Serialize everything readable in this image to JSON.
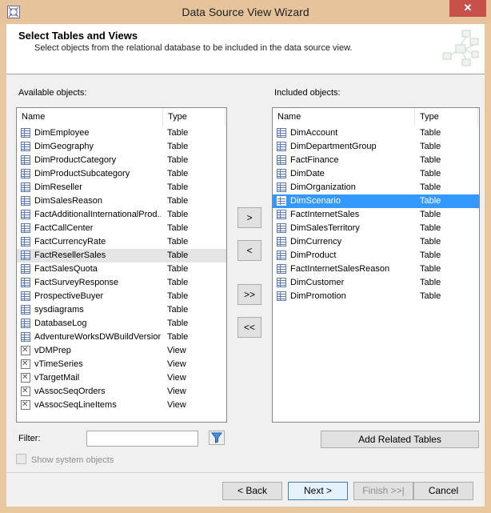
{
  "window": {
    "title": "Data Source View Wizard",
    "close_glyph": "✕"
  },
  "header": {
    "title": "Select Tables and Views",
    "subtitle": "Select objects from the relational database to be included in the data source view."
  },
  "available": {
    "label": "Available objects:",
    "col_name": "Name",
    "col_type": "Type",
    "rows": [
      {
        "name": "DimEmployee",
        "type": "Table",
        "icon": "table-icon"
      },
      {
        "name": "DimGeography",
        "type": "Table",
        "icon": "table-icon"
      },
      {
        "name": "DimProductCategory",
        "type": "Table",
        "icon": "table-icon"
      },
      {
        "name": "DimProductSubcategory",
        "type": "Table",
        "icon": "table-icon"
      },
      {
        "name": "DimReseller",
        "type": "Table",
        "icon": "table-icon"
      },
      {
        "name": "DimSalesReason",
        "type": "Table",
        "icon": "table-icon"
      },
      {
        "name": "FactAdditionalInternationalProd...",
        "type": "Table",
        "icon": "table-icon"
      },
      {
        "name": "FactCallCenter",
        "type": "Table",
        "icon": "table-icon"
      },
      {
        "name": "FactCurrencyRate",
        "type": "Table",
        "icon": "table-icon"
      },
      {
        "name": "FactResellerSales",
        "type": "Table",
        "icon": "table-icon",
        "highlighted": true
      },
      {
        "name": "FactSalesQuota",
        "type": "Table",
        "icon": "table-icon"
      },
      {
        "name": "FactSurveyResponse",
        "type": "Table",
        "icon": "table-icon"
      },
      {
        "name": "ProspectiveBuyer",
        "type": "Table",
        "icon": "table-icon"
      },
      {
        "name": "sysdiagrams",
        "type": "Table",
        "icon": "table-icon"
      },
      {
        "name": "DatabaseLog",
        "type": "Table",
        "icon": "table-icon"
      },
      {
        "name": "AdventureWorksDWBuildVersion",
        "type": "Table",
        "icon": "table-icon"
      },
      {
        "name": "vDMPrep",
        "type": "View",
        "icon": "view-icon"
      },
      {
        "name": "vTimeSeries",
        "type": "View",
        "icon": "view-icon"
      },
      {
        "name": "vTargetMail",
        "type": "View",
        "icon": "view-icon"
      },
      {
        "name": "vAssocSeqOrders",
        "type": "View",
        "icon": "view-icon"
      },
      {
        "name": "vAssocSeqLineItems",
        "type": "View",
        "icon": "view-icon"
      }
    ]
  },
  "included": {
    "label": "Included objects:",
    "col_name": "Name",
    "col_type": "Type",
    "rows": [
      {
        "name": "DimAccount",
        "type": "Table",
        "icon": "table-icon"
      },
      {
        "name": "DimDepartmentGroup",
        "type": "Table",
        "icon": "table-icon"
      },
      {
        "name": "FactFinance",
        "type": "Table",
        "icon": "table-icon"
      },
      {
        "name": "DimDate",
        "type": "Table",
        "icon": "table-icon"
      },
      {
        "name": "DimOrganization",
        "type": "Table",
        "icon": "table-icon"
      },
      {
        "name": "DimScenario",
        "type": "Table",
        "icon": "table-icon",
        "selected": true
      },
      {
        "name": "FactInternetSales",
        "type": "Table",
        "icon": "table-icon"
      },
      {
        "name": "DimSalesTerritory",
        "type": "Table",
        "icon": "table-icon"
      },
      {
        "name": "DimCurrency",
        "type": "Table",
        "icon": "table-icon"
      },
      {
        "name": "DimProduct",
        "type": "Table",
        "icon": "table-icon"
      },
      {
        "name": "FactInternetSalesReason",
        "type": "Table",
        "icon": "table-icon"
      },
      {
        "name": "DimCustomer",
        "type": "Table",
        "icon": "table-icon"
      },
      {
        "name": "DimPromotion",
        "type": "Table",
        "icon": "table-icon"
      }
    ]
  },
  "move_buttons": {
    "add": ">",
    "remove": "<",
    "add_all": ">>",
    "remove_all": "<<"
  },
  "filter": {
    "label": "Filter:",
    "value": ""
  },
  "show_system_objects": {
    "label": "Show system objects",
    "checked": false
  },
  "add_related_label": "Add Related Tables",
  "footer": {
    "back": "< Back",
    "next": "Next >",
    "finish": "Finish >>|",
    "cancel": "Cancel"
  },
  "colors": {
    "selection": "#3399ff",
    "title_bar": "#e6c39a",
    "close_button": "#c7504a"
  }
}
